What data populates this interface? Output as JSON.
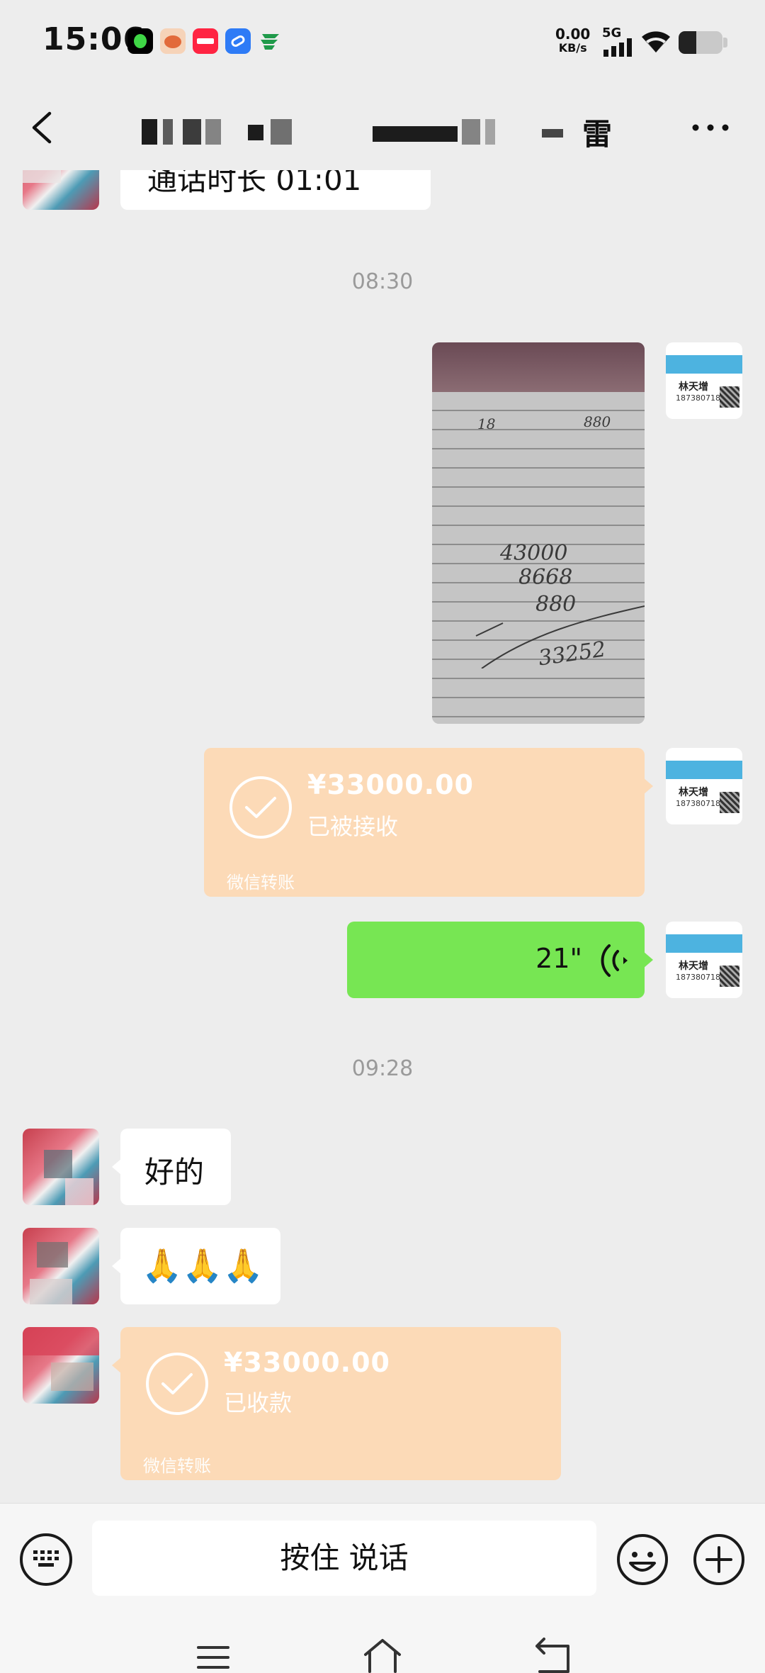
{
  "status_bar": {
    "time": "15:06",
    "net_speed_value": "0.00",
    "net_speed_unit": "KB/s",
    "network_type": "5G",
    "app_icons": [
      "music-app-icon",
      "cartoon-app-icon",
      "xiaohongshu-app-icon",
      "blue-app-icon",
      "china-post-app-icon"
    ],
    "battery_level_percent": 40
  },
  "header": {
    "title_visible_char": "雷",
    "back_icon": "chevron-left-icon",
    "more_icon": "more-dots-icon"
  },
  "messages": {
    "call_duration": "通话时长 01:01",
    "timestamp_1": "08:30",
    "photo_handwriting": {
      "line1": "18",
      "line2": "880",
      "line3": "43000",
      "line4": "8668",
      "line5": "880",
      "line6": "33252"
    },
    "transfer_sent": {
      "amount": "¥33000.00",
      "status": "已被接收",
      "footer": "微信转账"
    },
    "voice_duration": "21\"",
    "timestamp_2": "09:28",
    "reply_text": "好的",
    "reply_emoji": "🙏🙏🙏",
    "transfer_received": {
      "amount": "¥33000.00",
      "status": "已收款",
      "footer": "微信转账"
    }
  },
  "my_avatar": {
    "name": "林天增",
    "phone": "18738071885"
  },
  "input_bar": {
    "hold_to_talk": "按住 说话"
  },
  "colors": {
    "transfer_bg": "#fcdab7",
    "voice_bubble": "#77e653",
    "chat_bg": "#ededed"
  }
}
